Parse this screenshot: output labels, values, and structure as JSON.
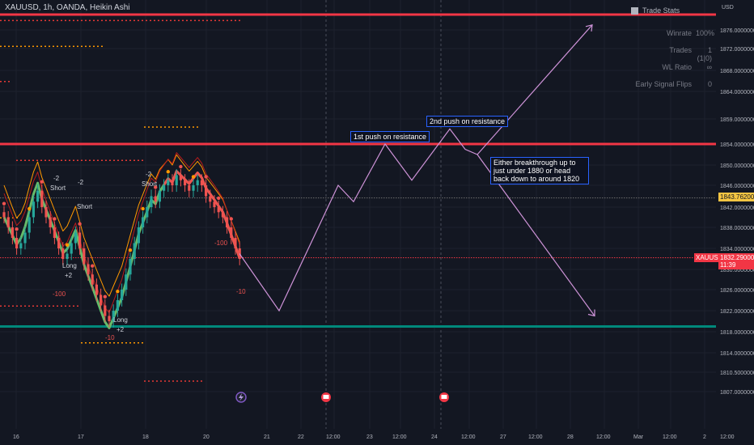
{
  "header": {
    "title": "XAUUSD, 1h, OANDA, Heikin Ashi"
  },
  "axis": {
    "currency": "USD"
  },
  "stats": {
    "title": "Trade Stats",
    "rows": [
      {
        "label": "Winrate",
        "value": "100%"
      },
      {
        "label": "Trades",
        "value": "1 (1|0)"
      },
      {
        "label": "WL Ratio",
        "value": "∞"
      },
      {
        "label": "Early Signal Flips",
        "value": "0"
      }
    ]
  },
  "annotations": [
    {
      "text": "1st push on resistance"
    },
    {
      "text": "2nd push on resistance"
    },
    {
      "text": "Either breakthrough up to just under 1880 or head back down to around 1820"
    }
  ],
  "price_badges": {
    "yellow": "1843.7620000",
    "symbol": "XAUUSD",
    "current": "1832.2900000",
    "countdown": "11:39"
  },
  "colors": {
    "background": "#131722",
    "resistance": "#f23645",
    "support": "#00897b",
    "projection": "#ce93d8",
    "bullish": "#26a69a",
    "bearish": "#ef5350",
    "signal_dots": "#ff9800"
  },
  "signals": [
    "-2",
    "Short",
    "Long",
    "+2",
    "-100",
    "-10"
  ],
  "chart_data": {
    "type": "candlestick",
    "symbol": "XAUUSD",
    "interval": "1h",
    "style": "Heikin Ashi",
    "ylim": [
      1805,
      1880
    ],
    "y_ticks": [
      "1876.0000000",
      "1872.0000000",
      "1868.0000000",
      "1864.0000000",
      "1859.0000000",
      "1854.0000000",
      "1850.0000000",
      "1846.0000000",
      "1842.0000000",
      "1838.0000000",
      "1834.0000000",
      "1830.0000000",
      "1826.0000000",
      "1822.0000000",
      "1818.0000000",
      "1814.0000000",
      "1810.5000000",
      "1807.0000000"
    ],
    "x_ticks": [
      "16",
      "17",
      "18",
      "20",
      "21",
      "22",
      "12:00",
      "23",
      "12:00",
      "24",
      "12:00",
      "27",
      "12:00",
      "28",
      "12:00",
      "Mar",
      "12:00",
      "2",
      "12:00"
    ],
    "horizontal_lines": [
      {
        "name": "resistance top",
        "price": 1879
      },
      {
        "name": "resistance",
        "price": 1854
      },
      {
        "name": "support",
        "price": 1819
      }
    ],
    "projection_path": {
      "x": [
        "21 16:00",
        "22 02:00",
        "22 20:00",
        "23 00:00",
        "23 22:00",
        "24 06:00",
        "24 22:00",
        "25 08:00",
        "25 12:00"
      ],
      "y": [
        1833,
        1822,
        1846,
        1843,
        1854,
        1847,
        1857,
        1853,
        1852
      ]
    },
    "projection_branches": {
      "up": {
        "from": 1852,
        "to": 1877
      },
      "down": {
        "from": 1852,
        "to": 1821
      }
    },
    "candles_close": [
      1840,
      1838,
      1836,
      1834,
      1835,
      1837,
      1840,
      1843,
      1845,
      1842,
      1840,
      1838,
      1836,
      1834,
      1832,
      1833,
      1835,
      1837,
      1834,
      1831,
      1829,
      1827,
      1825,
      1823,
      1821,
      1820,
      1822,
      1824,
      1826,
      1829,
      1832,
      1835,
      1838,
      1840,
      1842,
      1844,
      1843,
      1845,
      1846,
      1847,
      1846,
      1848,
      1847,
      1846,
      1845,
      1846,
      1847,
      1846,
      1844,
      1843,
      1842,
      1841,
      1840,
      1838,
      1836,
      1834,
      1832
    ]
  }
}
